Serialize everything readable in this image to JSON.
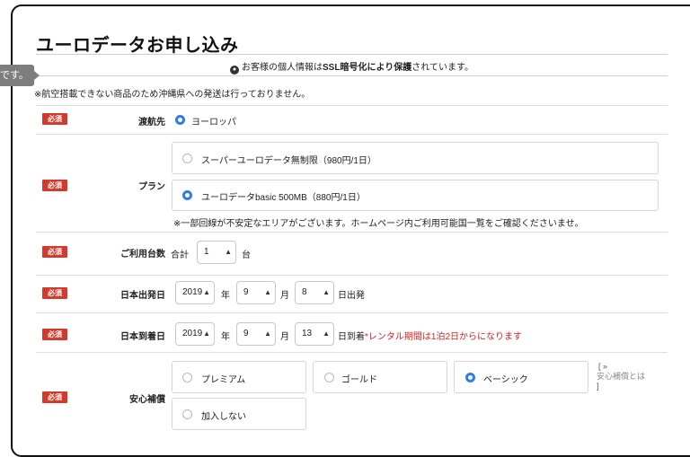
{
  "page": {
    "title": "ユーロデータお申し込み",
    "ssl_notice": {
      "prefix": "お客様の個人情報は",
      "bold": "SSL暗号化により保護",
      "suffix": "されています。"
    },
    "tooltip_text": "です。",
    "shipping_notice": "※航空搭載できない商品のため沖縄県への発送は行っておりません。",
    "required_badge": "必須"
  },
  "form": {
    "destination": {
      "label": "渡航先",
      "option": "ヨーロッパ",
      "selected": true
    },
    "plan": {
      "label": "プラン",
      "options": [
        {
          "label": "スーパーユーロデータ無制限（980円/1日）",
          "selected": false
        },
        {
          "label": "ユーロデータbasic 500MB（880円/1日）",
          "selected": true
        }
      ],
      "note": "※一部回線が不安定なエリアがございます。ホームページ内ご利用可能国一覧をご確認くださいませ。"
    },
    "units": {
      "label": "ご利用台数",
      "prefix": "合計",
      "value": "1",
      "suffix": "台"
    },
    "departure": {
      "label": "日本出発日",
      "year": "2019",
      "year_suffix": "年",
      "month": "9",
      "month_suffix": "月",
      "day": "8",
      "day_suffix": "日出発"
    },
    "arrival": {
      "label": "日本到着日",
      "year": "2019",
      "year_suffix": "年",
      "month": "9",
      "month_suffix": "月",
      "day": "13",
      "day_suffix": "日到着",
      "warning": "*レンタル期間は1泊2日からになります"
    },
    "insurance": {
      "label": "安心補償",
      "options": [
        {
          "label": "プレミアム",
          "selected": false
        },
        {
          "label": "ゴールド",
          "selected": false
        },
        {
          "label": "ベーシック",
          "selected": true
        },
        {
          "label": "加入しない",
          "selected": false
        }
      ],
      "link_open": "[ »",
      "link_text": "安心補償とは",
      "link_close": "]"
    }
  },
  "colors": {
    "accent": "#2f7bf0",
    "required": "#d33a2c",
    "warning": "#e02020"
  },
  "icons": {
    "lock": "lock-icon",
    "select_arrow": "updown-arrow-icon"
  }
}
